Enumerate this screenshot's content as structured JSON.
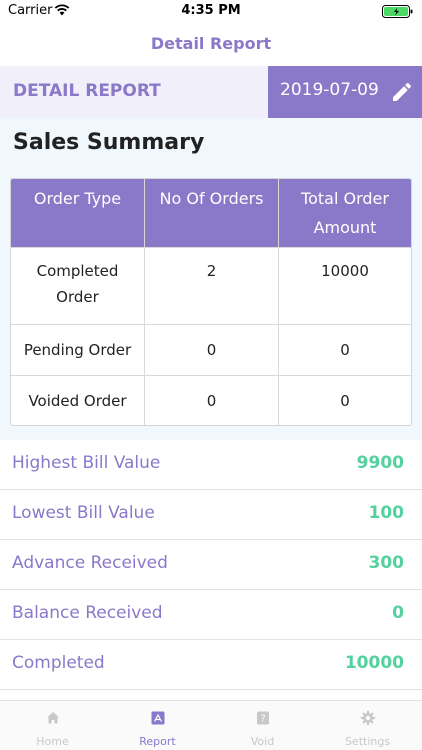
{
  "status_bar": {
    "carrier": "Carrier",
    "time": "4:35 PM"
  },
  "nav": {
    "title": "Detail Report"
  },
  "report_header": {
    "title": "DETAIL REPORT",
    "date": "2019-07-09"
  },
  "summary": {
    "title": "Sales Summary",
    "columns": [
      "Order Type",
      "No Of Orders",
      "Total Order Amount"
    ],
    "rows": [
      {
        "type": "Completed Order",
        "count": "2",
        "amount": "10000"
      },
      {
        "type": "Pending Order",
        "count": "0",
        "amount": "0"
      },
      {
        "type": "Voided Order",
        "count": "0",
        "amount": "0"
      }
    ]
  },
  "metrics": [
    {
      "label": "Highest Bill Value",
      "value": "9900"
    },
    {
      "label": "Lowest Bill Value",
      "value": "100"
    },
    {
      "label": "Advance Received",
      "value": "300"
    },
    {
      "label": "Balance Received",
      "value": "0"
    },
    {
      "label": "Completed",
      "value": "10000"
    }
  ],
  "tabs": [
    {
      "label": "Home",
      "icon": "home-icon",
      "active": false
    },
    {
      "label": "Report",
      "icon": "report-icon",
      "active": true
    },
    {
      "label": "Void",
      "icon": "void-icon",
      "active": false
    },
    {
      "label": "Settings",
      "icon": "settings-icon",
      "active": false
    }
  ],
  "colors": {
    "accent": "#8a78c9",
    "value_green": "#55d1a0",
    "summary_bg": "#f1f8fd",
    "header_bg": "#f1f0fa"
  }
}
